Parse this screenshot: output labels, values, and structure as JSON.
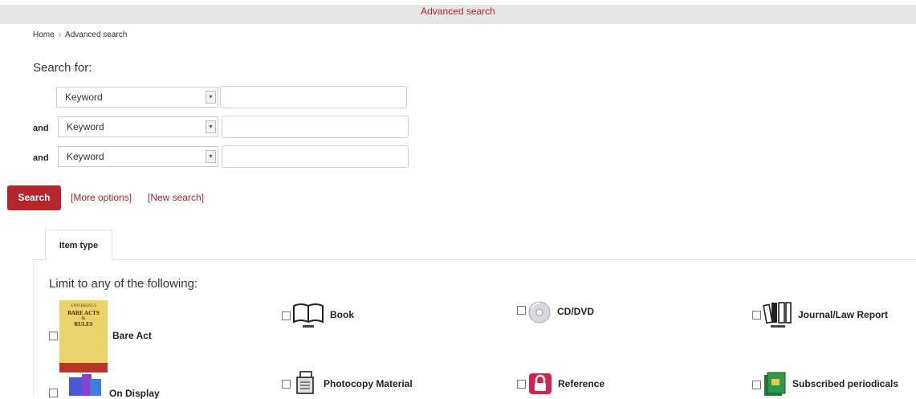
{
  "header": {
    "title": "Advanced search"
  },
  "breadcrumb": {
    "home": "Home",
    "separator": "›",
    "current": "Advanced search"
  },
  "form": {
    "heading": "Search for:",
    "rows": [
      {
        "conj": "",
        "field": "Keyword",
        "value": ""
      },
      {
        "conj": "and",
        "field": "Keyword",
        "value": ""
      },
      {
        "conj": "and",
        "field": "Keyword",
        "value": ""
      }
    ],
    "search_label": "Search",
    "more_options": "[More options]",
    "new_search": "[New search]"
  },
  "tabs": {
    "item_type": "Item type"
  },
  "limits": {
    "heading": "Limit to any of the following:",
    "items": [
      {
        "label": "Bare Act",
        "icon": "book-cover-icon"
      },
      {
        "label": "Book",
        "icon": "book-icon"
      },
      {
        "label": "CD/DVD",
        "icon": "disc-icon"
      },
      {
        "label": "Journal/Law Report",
        "icon": "journal-icon"
      },
      {
        "label": "On Display",
        "icon": "display-icon"
      },
      {
        "label": "Photocopy Material",
        "icon": "photocopy-icon"
      },
      {
        "label": "Reference",
        "icon": "lock-icon"
      },
      {
        "label": "Subscribed periodicals",
        "icon": "periodical-icon"
      }
    ],
    "bare_act_cover": {
      "line1": "UNIVERSAL'S",
      "line2": "BARE ACTS",
      "line3": "&",
      "line4": "RULES"
    }
  },
  "colors": {
    "accent": "#b7252c",
    "topbar": "#e6e6e6"
  }
}
